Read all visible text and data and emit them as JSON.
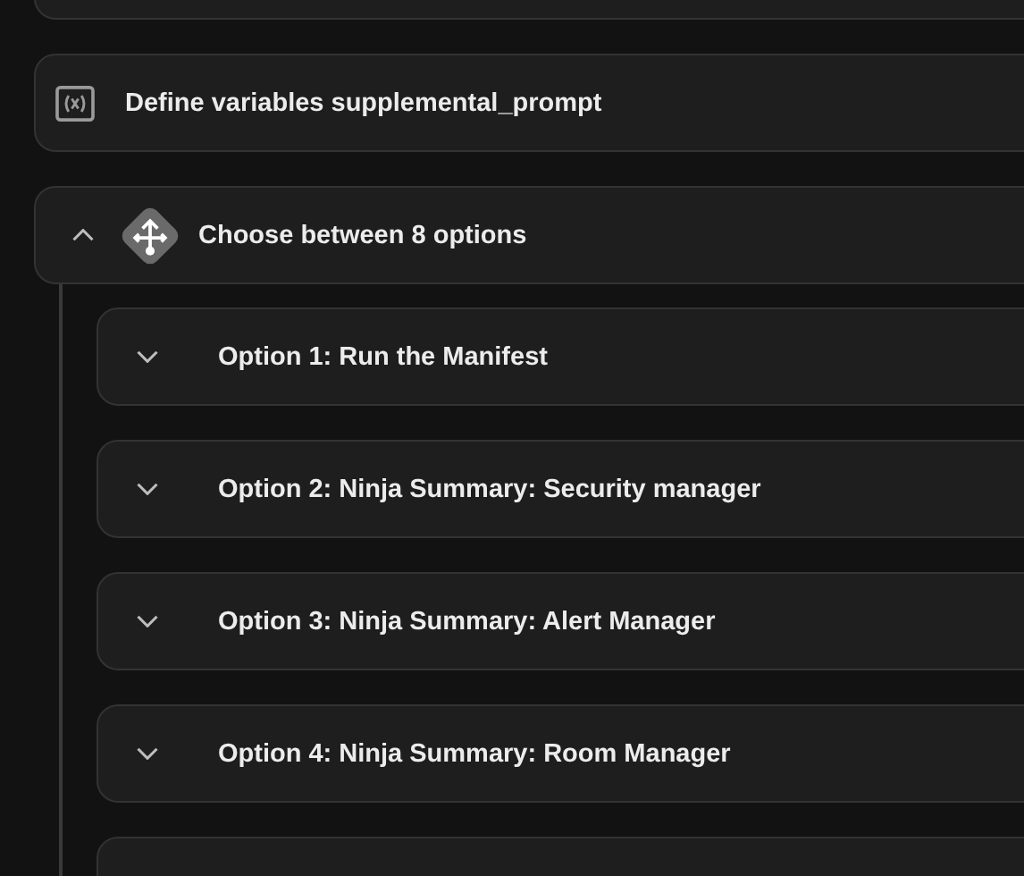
{
  "steps": [
    {
      "kind": "variables",
      "title": "Define variables supplemental_prompt"
    },
    {
      "kind": "choice",
      "title": "Choose between 8 options",
      "expanded": true,
      "options": [
        {
          "title": "Option 1: Run the Manifest",
          "expanded": false
        },
        {
          "title": "Option 2: Ninja Summary: Security manager",
          "expanded": false
        },
        {
          "title": "Option 3: Ninja Summary: Alert Manager",
          "expanded": false
        },
        {
          "title": "Option 4: Ninja Summary: Room Manager",
          "expanded": false
        }
      ]
    }
  ]
}
